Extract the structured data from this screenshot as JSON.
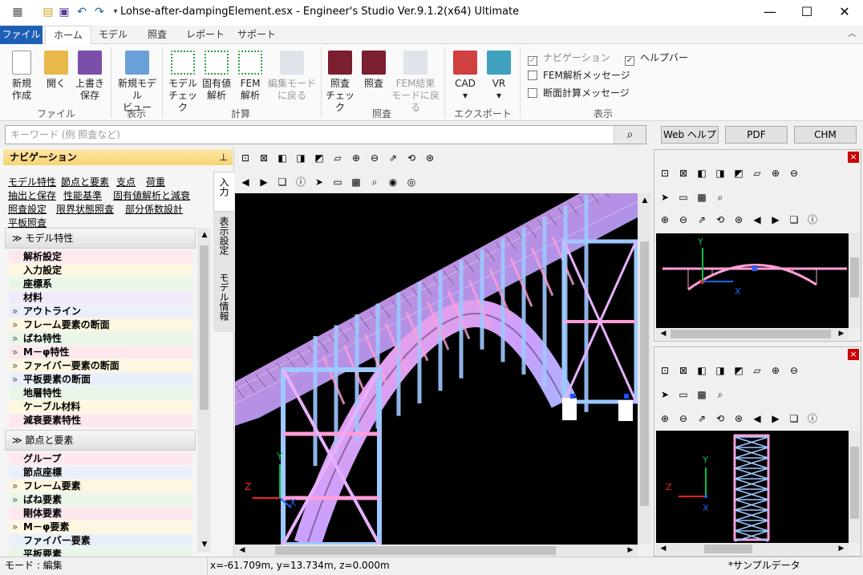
{
  "window": {
    "title": "Lohse-after-dampingElement.esx - Engineer's Studio Ver.9.1.2(x64) Ultimate",
    "minimize": "—",
    "maximize": "☐",
    "close": "✕"
  },
  "menu": {
    "file": "ファイル",
    "tabs": [
      "ホーム",
      "モデル",
      "照査",
      "レポート",
      "サポート"
    ]
  },
  "ribbon": {
    "buttons": [
      {
        "label1": "新規",
        "label2": "作成",
        "color": "#ffffff"
      },
      {
        "label1": "開く",
        "label2": "",
        "color": "#e8b84a"
      },
      {
        "label1": "上書き",
        "label2": "保存",
        "color": "#7b4fa8"
      },
      {
        "label1": "新規モデル",
        "label2": "ビュー",
        "color": "#6aa0d8"
      },
      {
        "label1": "モデル",
        "label2": "チェック",
        "color": "#4caf50"
      },
      {
        "label1": "固有値",
        "label2": "解析",
        "color": "#4caf50"
      },
      {
        "label1": "FEM",
        "label2": "解析",
        "color": "#4caf50"
      },
      {
        "label1": "編集モード",
        "label2": "に戻る",
        "color": "#b8c4d4"
      },
      {
        "label1": "照査",
        "label2": "チェック",
        "color": "#a0304a"
      },
      {
        "label1": "照査",
        "label2": "",
        "color": "#a0304a"
      },
      {
        "label1": "FEM結果",
        "label2": "モードに戻る",
        "color": "#b8c4d4"
      },
      {
        "label1": "CAD",
        "label2": "▾",
        "color": "#d04040"
      },
      {
        "label1": "VR",
        "label2": "▾",
        "color": "#40a0c0"
      }
    ],
    "groups": [
      "ファイル",
      "表示",
      "計算",
      "照査",
      "エクスポート",
      "表示"
    ],
    "checks": [
      {
        "label": "ナビゲーション",
        "checked": "✓"
      },
      {
        "label": "FEM解析メッセージ",
        "checked": ""
      },
      {
        "label": "断面計算メッセージ",
        "checked": ""
      },
      {
        "label": "ヘルプバー",
        "checked": "✓"
      }
    ]
  },
  "search": {
    "placeholder": "キーワード (例 照査など)",
    "button_icon": "magnifier-icon",
    "web_help": "Web ヘルプ",
    "pdf": "PDF",
    "chm": "CHM"
  },
  "navigation": {
    "title": "ナビゲーション",
    "pin": "ｷ",
    "links": [
      "モデル特性",
      "節点と要素",
      "支点",
      "荷重",
      "抽出と保存",
      "性能基準",
      "固有値解析と減衰",
      "照査設定",
      "限界状態照査",
      "部分係数設計",
      "平板照査"
    ],
    "vtabs": [
      "入力",
      "表示設定",
      "モデル情報"
    ],
    "section1": {
      "title": "モデル特性",
      "items": [
        {
          "label": "解析設定",
          "arrow": "",
          "bg": "#fde8ee"
        },
        {
          "label": "入力設定",
          "arrow": "",
          "bg": "#fdf6e0"
        },
        {
          "label": "座標系",
          "arrow": "",
          "bg": "#eaf6e8"
        },
        {
          "label": "材料",
          "arrow": "",
          "bg": "#f0ebfa"
        },
        {
          "label": "アウトライン",
          "arrow": "»",
          "bg": "#eaf0fb"
        },
        {
          "label": "フレーム要素の断面",
          "arrow": "»",
          "bg": "#fdf6e0"
        },
        {
          "label": "ばね特性",
          "arrow": "»",
          "bg": "#eaf6e8"
        },
        {
          "label": "M－φ特性",
          "arrow": "»",
          "bg": "#fde8ee"
        },
        {
          "label": "ファイバー要素の断面",
          "arrow": "»",
          "bg": "#fdf6e0"
        },
        {
          "label": "平板要素の断面",
          "arrow": "»",
          "bg": "#eaf0fb"
        },
        {
          "label": "地層特性",
          "arrow": "",
          "bg": "#eaf6e8"
        },
        {
          "label": "ケーブル材料",
          "arrow": "",
          "bg": "#fdf6e0"
        },
        {
          "label": "減衰要素特性",
          "arrow": "",
          "bg": "#fde8ee"
        }
      ]
    },
    "section2": {
      "title": "節点と要素",
      "items": [
        {
          "label": "グループ",
          "arrow": "",
          "bg": "#fde8ee"
        },
        {
          "label": "節点座標",
          "arrow": "",
          "bg": "#eaf0fb"
        },
        {
          "label": "フレーム要素",
          "arrow": "»",
          "bg": "#fdf6e0"
        },
        {
          "label": "ばね要素",
          "arrow": "»",
          "bg": "#eaf6e8"
        },
        {
          "label": "剛体要素",
          "arrow": "",
          "bg": "#fde8ee"
        },
        {
          "label": "M－φ要素",
          "arrow": "»",
          "bg": "#fdf6e0"
        },
        {
          "label": "ファイバー要素",
          "arrow": "",
          "bg": "#eaf0fb"
        },
        {
          "label": "平板要素",
          "arrow": "",
          "bg": "#eaf6e8"
        }
      ]
    }
  },
  "viewport": {
    "axis_y": "Y",
    "axis_z": "Z",
    "axis_x": "X"
  },
  "status": {
    "mode": "モード : 編集",
    "coords": "x=-61.709m, y=13.734m, z=0.000m",
    "sample": "*サンプルデータ"
  }
}
